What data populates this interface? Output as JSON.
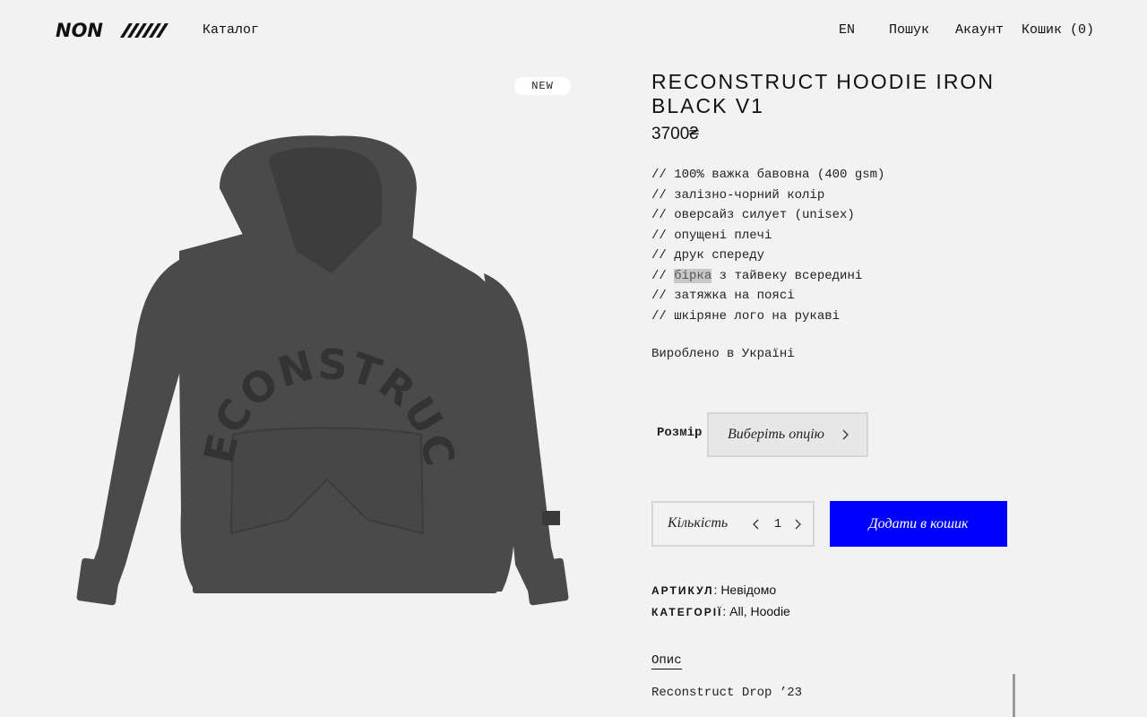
{
  "header": {
    "logo_text": "NON/////",
    "catalog": "Каталог",
    "lang": "EN",
    "search": "Пошук",
    "account": "Акаунт",
    "cart": "Кошик (0)"
  },
  "product": {
    "badge": "NEW",
    "title": "RECONSTRUCT HOODIE IRON BLACK V1",
    "price": "3700₴",
    "features": [
      "// 100% важка бавовна (400 gsm)",
      "// залізно-чорний колір",
      "// оверсайз силует (unisex)",
      "// опущені плечі",
      "// друк спереду",
      "// бірка з тайвеку всередині",
      "// затяжка на поясі",
      "// шкіряне лого на рукаві"
    ],
    "feature_6_prefix": "// ",
    "feature_6_highlight": "бірка",
    "feature_6_suffix": " з тайвеку всередині",
    "made_in": "Вироблено в Україні",
    "image_print_text": "RECONSTRUCT"
  },
  "size": {
    "label": "Розмір",
    "placeholder": "Виберіть опцію"
  },
  "quantity": {
    "label": "Кількість",
    "value": "1"
  },
  "add_to_cart": "Додати в кошик",
  "meta": {
    "sku_key": "АРТИКУЛ",
    "sku_value": "Невідомо",
    "cat_key": "КАТЕГОРІЇ",
    "cat_value": "All, Hoodie"
  },
  "description": {
    "tab": "Опис",
    "text": "Reconstruct Drop ’23"
  },
  "colors": {
    "background": "#f2f2f2",
    "accent": "#0000ff",
    "hoodie": "#4a4a4a"
  }
}
